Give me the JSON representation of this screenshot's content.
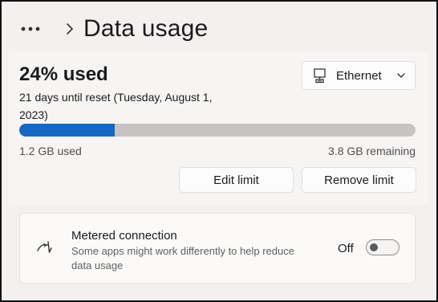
{
  "header": {
    "more_icon": "more-horizontal-icon",
    "separator_icon": "chevron-right-icon",
    "title": "Data usage"
  },
  "usage": {
    "used_title": "24% used",
    "reset_text": "21 days until reset (Tuesday, August 1, 2023)",
    "progress_fraction": 0.24,
    "used_amount": "1.2 GB used",
    "remaining_amount": "3.8 GB remaining",
    "network": {
      "icon": "ethernet-icon",
      "label": "Ethernet"
    },
    "edit_limit_label": "Edit limit",
    "remove_limit_label": "Remove limit"
  },
  "metered": {
    "icon": "metered-connection-icon",
    "title": "Metered connection",
    "description": "Some apps might work differently to help reduce data usage",
    "toggle_state_label": "Off",
    "toggle_on": false
  },
  "colors": {
    "accent": "#1767c4",
    "track": "#c7c3c2",
    "background": "#f3f0ef"
  }
}
